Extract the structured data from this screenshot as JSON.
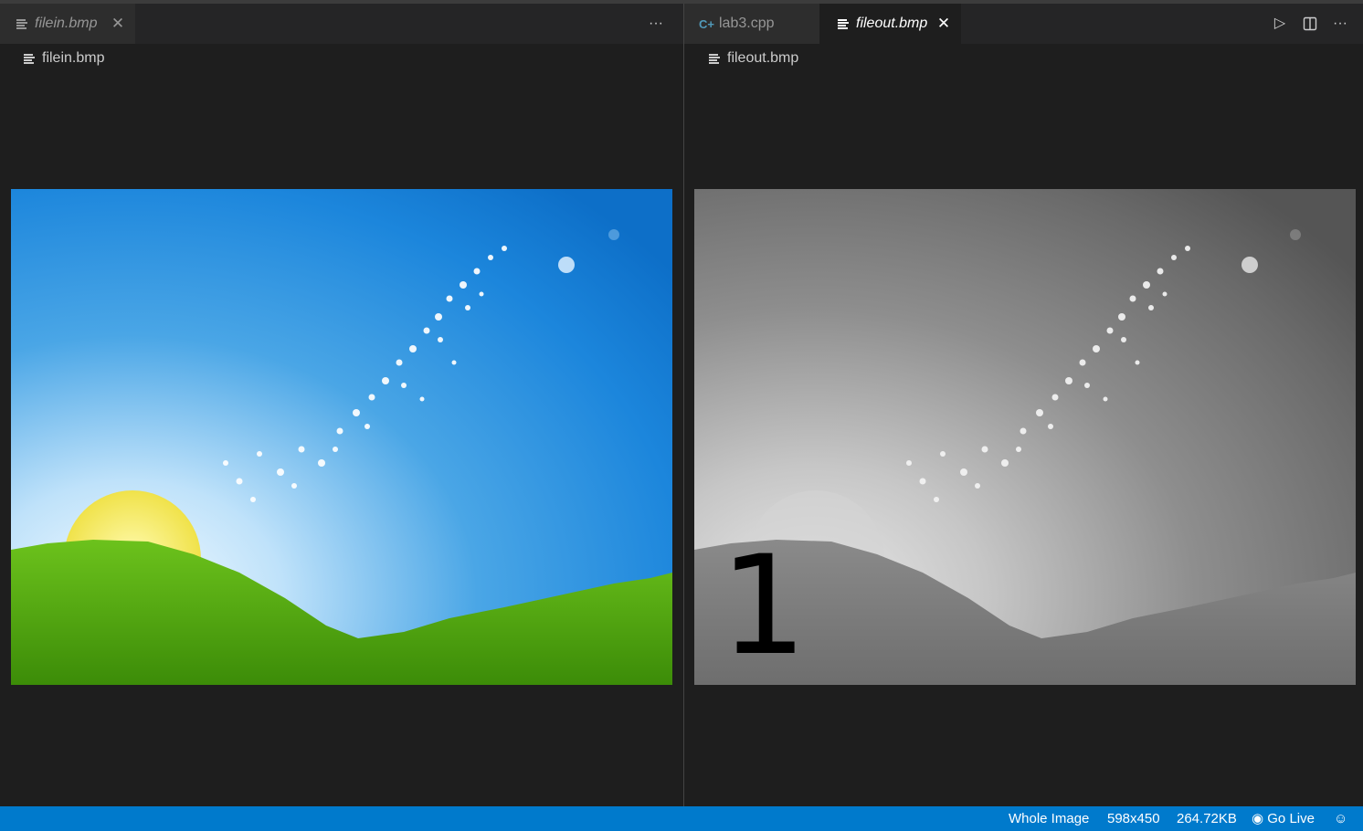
{
  "left_group": {
    "tabs": [
      {
        "label": "filein.bmp",
        "italic": true,
        "active": false
      }
    ],
    "breadcrumb": "filein.bmp",
    "more_actions_icon": "ellipsis-icon"
  },
  "right_group": {
    "tabs": [
      {
        "label": "lab3.cpp",
        "italic": false,
        "active": false,
        "icon": "cpp-icon"
      },
      {
        "label": "fileout.bmp",
        "italic": true,
        "active": true,
        "icon": "file-lines-icon"
      }
    ],
    "breadcrumb": "fileout.bmp",
    "actions": [
      "run-icon",
      "split-editor-icon",
      "ellipsis-icon"
    ],
    "overlay_text": "1"
  },
  "statusbar": {
    "zoom_mode": "Whole Image",
    "dimensions": "598x450",
    "file_size": "264.72KB",
    "go_live": "Go Live",
    "go_live_icon": "broadcast-icon",
    "remote_icon": "feedback-icon",
    "background_color": "#007acc"
  },
  "colors": {
    "editor_bg": "#1e1e1e",
    "tabbar_bg": "#252526",
    "inactive_tab_bg": "#2d2d2d"
  }
}
